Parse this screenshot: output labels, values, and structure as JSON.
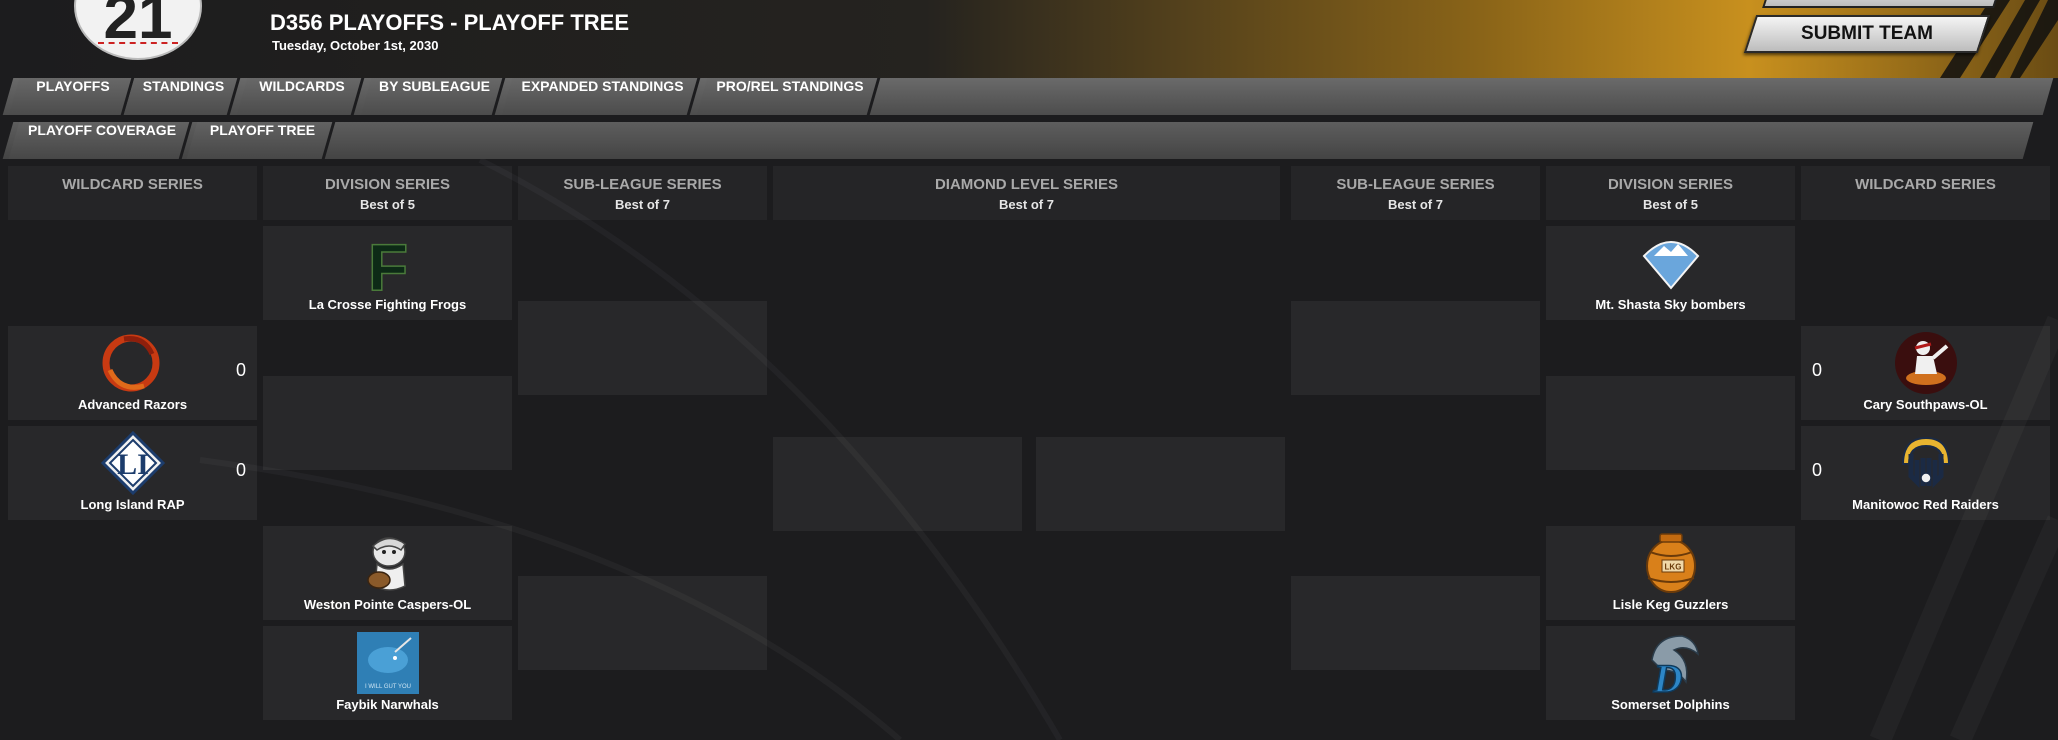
{
  "header": {
    "title": "D356 PLAYOFFS - PLAYOFF TREE",
    "date": "Tuesday, October 1st, 2030",
    "logo_text": "21",
    "submit_label": "SUBMIT TEAM"
  },
  "tabs": [
    "PLAYOFFS",
    "STANDINGS",
    "WILDCARDS",
    "BY SUBLEAGUE",
    "EXPANDED STANDINGS",
    "PRO/REL STANDINGS"
  ],
  "subtabs": [
    "PLAYOFF COVERAGE",
    "PLAYOFF TREE"
  ],
  "columns": [
    {
      "title": "WILDCARD SERIES",
      "sub": ""
    },
    {
      "title": "DIVISION SERIES",
      "sub": "Best of 5"
    },
    {
      "title": "SUB-LEAGUE SERIES",
      "sub": "Best of 7"
    },
    {
      "title": "DIAMOND LEVEL SERIES",
      "sub": "Best of 7"
    },
    {
      "title": "SUB-LEAGUE SERIES",
      "sub": "Best of 7"
    },
    {
      "title": "DIVISION SERIES",
      "sub": "Best of 5"
    },
    {
      "title": "WILDCARD SERIES",
      "sub": ""
    }
  ],
  "teams": {
    "left_wc_1": {
      "name": "Advanced Razors",
      "score": "0",
      "icon": "razors-logo-icon"
    },
    "left_wc_2": {
      "name": "Long Island RAP",
      "score": "0",
      "icon": "long-island-rap-logo-icon"
    },
    "left_div_1": {
      "name": "La Crosse Fighting Frogs",
      "icon": "fighting-frogs-logo-icon"
    },
    "left_div_3": {
      "name": "Weston Pointe Caspers-OL",
      "icon": "caspers-logo-icon"
    },
    "left_div_4": {
      "name": "Faybik Narwhals",
      "icon": "narwhals-logo-icon",
      "logo_text": "I WILL GUT YOU"
    },
    "right_div_1": {
      "name": "Mt. Shasta Sky bombers",
      "icon": "sky-bombers-logo-icon"
    },
    "right_div_3": {
      "name": "Lisle Keg Guzzlers",
      "icon": "keg-guzzlers-logo-icon",
      "logo_text": "LKG"
    },
    "right_div_4": {
      "name": "Somerset Dolphins",
      "icon": "dolphins-logo-icon"
    },
    "right_wc_1": {
      "name": "Cary Southpaws-OL",
      "score": "0",
      "icon": "southpaws-logo-icon"
    },
    "right_wc_2": {
      "name": "Manitowoc Red Raiders",
      "score": "0",
      "icon": "red-raiders-logo-icon"
    }
  },
  "colors": {
    "accent_gold": "#c8901e",
    "panel": "#2a2a2c",
    "tab": "#5a5a5a"
  }
}
